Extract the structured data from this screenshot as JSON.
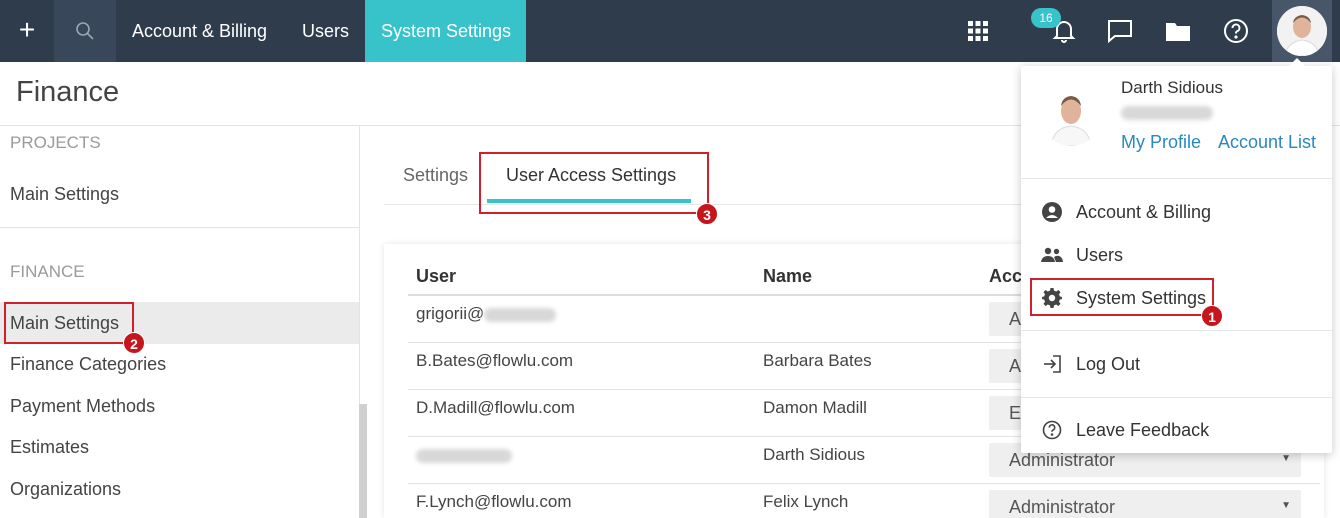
{
  "topbar": {
    "plus_icon": "plus-icon",
    "search_icon": "search-icon",
    "nav": [
      "Account & Billing",
      "Users",
      "System Settings"
    ],
    "active_nav": "System Settings",
    "notifications_count": "16",
    "icons": [
      "apps-grid-icon",
      "bell-icon",
      "chat-icon",
      "folder-icon",
      "help-icon"
    ],
    "accent_color": "#37c3c9",
    "bar_color": "#2f3c4c"
  },
  "page": {
    "title": "Finance"
  },
  "sidebar": {
    "sections": [
      {
        "heading": "PROJECTS",
        "items": [
          "Main Settings"
        ]
      },
      {
        "heading": "FINANCE",
        "items": [
          "Main Settings",
          "Finance Categories",
          "Payment Methods",
          "Estimates",
          "Organizations"
        ]
      }
    ],
    "active_item": "Main Settings"
  },
  "tabs": {
    "items": [
      "Settings",
      "User Access Settings"
    ],
    "active": "User Access Settings"
  },
  "table": {
    "columns": [
      "User",
      "Name",
      "Acce"
    ],
    "rows": [
      {
        "user": "grigorii@",
        "user_blurred_suffix": true,
        "name": "",
        "access": "A"
      },
      {
        "user": "B.Bates@flowlu.com",
        "name": "Barbara Bates",
        "access": "A"
      },
      {
        "user": "D.Madill@flowlu.com",
        "name": "Damon Madill",
        "access": "E"
      },
      {
        "user": "",
        "user_blurred": true,
        "name": "Darth Sidious",
        "access": "Administrator"
      },
      {
        "user": "F.Lynch@flowlu.com",
        "name": "Felix Lynch",
        "access": "Administrator"
      }
    ]
  },
  "user_menu": {
    "name": "Darth Sidious",
    "links": [
      "My Profile",
      "Account List"
    ],
    "items": [
      {
        "label": "Account & Billing",
        "icon": "account-circle-icon"
      },
      {
        "label": "Users",
        "icon": "users-icon"
      },
      {
        "label": "System Settings",
        "icon": "gear-icon"
      },
      {
        "label": "Log Out",
        "icon": "logout-icon"
      },
      {
        "label": "Leave Feedback",
        "icon": "help-circle-icon"
      }
    ]
  },
  "callouts": [
    "1",
    "2",
    "3"
  ],
  "callout_color": "#d0202a",
  "link_color": "#2a88c0"
}
